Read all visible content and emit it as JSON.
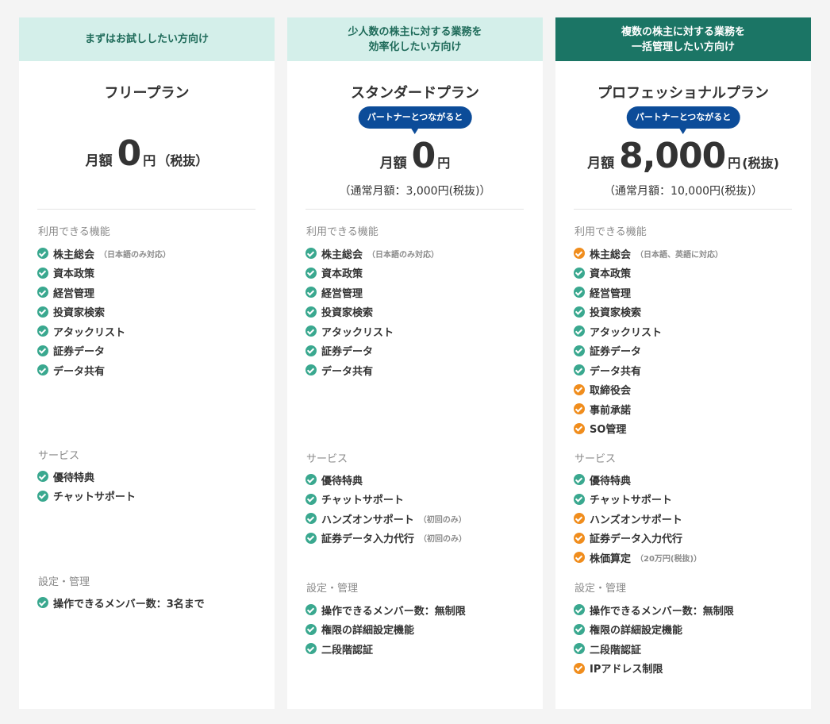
{
  "colors": {
    "check_green": "#3aa88f",
    "check_orange": "#f08d1d",
    "badge_blue": "#0c4c99",
    "header_light": "#d4efea",
    "header_dark": "#1b7565"
  },
  "plans": [
    {
      "target": "まずはお試ししたい方向け",
      "name": "フリープラン",
      "price": {
        "lead": "月額",
        "amount": "0",
        "unit": "円",
        "tax": "（税抜）"
      },
      "sections": [
        {
          "title": "利用できる機能",
          "items": [
            {
              "label": "株主総会",
              "note": "（日本語のみ対応）",
              "icon": "check-green"
            },
            {
              "label": "資本政策",
              "icon": "check-green"
            },
            {
              "label": "経営管理",
              "icon": "check-green"
            },
            {
              "label": "投資家検索",
              "icon": "check-green"
            },
            {
              "label": "アタックリスト",
              "icon": "check-green"
            },
            {
              "label": "証券データ",
              "icon": "check-green"
            },
            {
              "label": "データ共有",
              "icon": "check-green"
            }
          ]
        },
        {
          "title": "サービス",
          "items": [
            {
              "label": "優待特典",
              "icon": "check-green"
            },
            {
              "label": "チャットサポート",
              "icon": "check-green"
            }
          ]
        },
        {
          "title": "設定・管理",
          "items": [
            {
              "label": "操作できるメンバー数：3名まで",
              "icon": "check-green"
            }
          ]
        }
      ]
    },
    {
      "target_lines": [
        "少人数の株主に対する業務を",
        "効率化したい方向け"
      ],
      "name": "スタンダードプラン",
      "badge": "パートナーとつながると",
      "price": {
        "lead": "月額",
        "amount": "0",
        "unit": "円"
      },
      "regular_price": "（通常月額：3,000円(税抜)）",
      "sections": [
        {
          "title": "利用できる機能",
          "items": [
            {
              "label": "株主総会",
              "note": "（日本語のみ対応）",
              "icon": "check-green"
            },
            {
              "label": "資本政策",
              "icon": "check-green"
            },
            {
              "label": "経営管理",
              "icon": "check-green"
            },
            {
              "label": "投資家検索",
              "icon": "check-green"
            },
            {
              "label": "アタックリスト",
              "icon": "check-green"
            },
            {
              "label": "証券データ",
              "icon": "check-green"
            },
            {
              "label": "データ共有",
              "icon": "check-green"
            }
          ]
        },
        {
          "title": "サービス",
          "items": [
            {
              "label": "優待特典",
              "icon": "check-green"
            },
            {
              "label": "チャットサポート",
              "icon": "check-green"
            },
            {
              "label": "ハンズオンサポート",
              "note": "（初回のみ）",
              "icon": "check-green"
            },
            {
              "label": "証券データ入力代行",
              "note": "（初回のみ）",
              "icon": "check-green"
            }
          ]
        },
        {
          "title": "設定・管理",
          "items": [
            {
              "label": "操作できるメンバー数：無制限",
              "icon": "check-green"
            },
            {
              "label": "権限の詳細設定機能",
              "icon": "check-green"
            },
            {
              "label": "二段階認証",
              "icon": "check-green"
            }
          ]
        }
      ]
    },
    {
      "target_lines": [
        "複数の株主に対する業務を",
        "一括管理したい方向け"
      ],
      "name": "プロフェッショナルプラン",
      "badge": "パートナーとつながると",
      "price": {
        "lead": "月額",
        "amount": "8,000",
        "unit": "円",
        "tax": "(税抜)"
      },
      "regular_price": "（通常月額：10,000円(税抜)）",
      "sections": [
        {
          "title": "利用できる機能",
          "items": [
            {
              "label": "株主総会",
              "note": "（日本語、英語に対応）",
              "icon": "check-orange"
            },
            {
              "label": "資本政策",
              "icon": "check-green"
            },
            {
              "label": "経営管理",
              "icon": "check-green"
            },
            {
              "label": "投資家検索",
              "icon": "check-green"
            },
            {
              "label": "アタックリスト",
              "icon": "check-green"
            },
            {
              "label": "証券データ",
              "icon": "check-green"
            },
            {
              "label": "データ共有",
              "icon": "check-green"
            },
            {
              "label": "取締役会",
              "icon": "check-orange"
            },
            {
              "label": "事前承諾",
              "icon": "check-orange"
            },
            {
              "label": "SO管理",
              "icon": "check-orange"
            }
          ]
        },
        {
          "title": "サービス",
          "items": [
            {
              "label": "優待特典",
              "icon": "check-green"
            },
            {
              "label": "チャットサポート",
              "icon": "check-green"
            },
            {
              "label": "ハンズオンサポート",
              "icon": "check-orange"
            },
            {
              "label": "証券データ入力代行",
              "icon": "check-orange"
            },
            {
              "label": "株価算定",
              "note": "（20万円(税抜)）",
              "icon": "check-orange"
            }
          ]
        },
        {
          "title": "設定・管理",
          "items": [
            {
              "label": "操作できるメンバー数：無制限",
              "icon": "check-green"
            },
            {
              "label": "権限の詳細設定機能",
              "icon": "check-green"
            },
            {
              "label": "二段階認証",
              "icon": "check-green"
            },
            {
              "label": "IPアドレス制限",
              "icon": "check-orange"
            }
          ]
        }
      ]
    }
  ]
}
